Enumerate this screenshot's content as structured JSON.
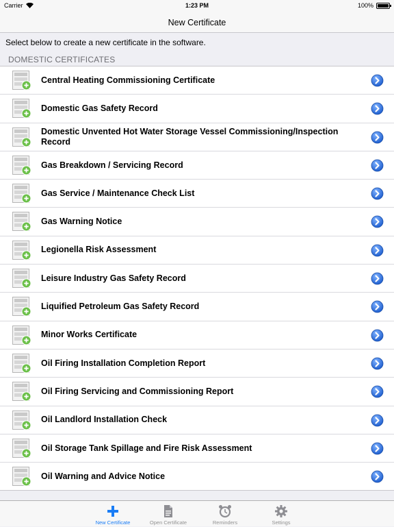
{
  "status_bar": {
    "carrier": "Carrier",
    "time": "1:23 PM",
    "battery": "100%"
  },
  "nav": {
    "title": "New Certificate"
  },
  "intro_text": "Select below to create a new certificate in the software.",
  "section_header": "DOMESTIC CERTIFICATES",
  "certificates": [
    "Central Heating Commissioning Certificate",
    "Domestic Gas Safety Record",
    "Domestic Unvented Hot Water Storage Vessel Commissioning/Inspection Record",
    "Gas Breakdown / Servicing Record",
    "Gas Service / Maintenance Check List",
    "Gas Warning Notice",
    "Legionella Risk Assessment",
    "Leisure Industry Gas Safety Record",
    "Liquified Petroleum Gas Safety Record",
    "Minor Works Certificate",
    "Oil Firing Installation Completion Report",
    "Oil Firing Servicing and Commissioning Report",
    "Oil Landlord Installation Check",
    "Oil Storage Tank Spillage and Fire Risk Assessment",
    "Oil Warning and Advice Notice"
  ],
  "tabs": [
    {
      "label": "New Certificate",
      "icon": "plus-icon",
      "active": true
    },
    {
      "label": "Open Certificate",
      "icon": "document-icon",
      "active": false
    },
    {
      "label": "Reminders",
      "icon": "alarm-clock-icon",
      "active": false
    },
    {
      "label": "Settings",
      "icon": "gear-icon",
      "active": false
    }
  ],
  "colors": {
    "accent": "#1a7df6",
    "badge_green": "#6cc04a",
    "disclosure_blue": "#2f6fd8"
  }
}
